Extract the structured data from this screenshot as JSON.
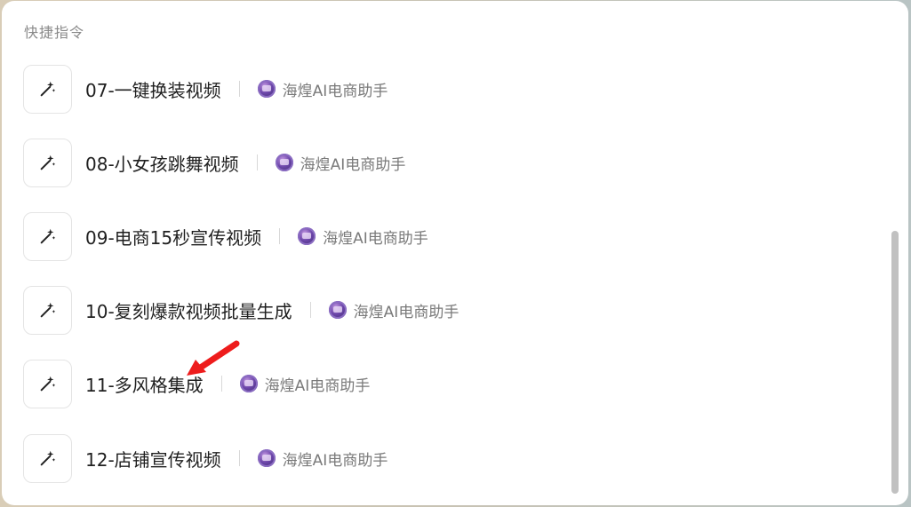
{
  "section_title": "快捷指令",
  "items": [
    {
      "title": "07-一键换装视频",
      "author": "海煌AI电商助手"
    },
    {
      "title": "08-小女孩跳舞视频",
      "author": "海煌AI电商助手"
    },
    {
      "title": "09-电商15秒宣传视频",
      "author": "海煌AI电商助手"
    },
    {
      "title": "10-复刻爆款视频批量生成",
      "author": "海煌AI电商助手"
    },
    {
      "title": "11-多风格集成",
      "author": "海煌AI电商助手"
    },
    {
      "title": "12-店铺宣传视频",
      "author": "海煌AI电商助手"
    }
  ],
  "icons": {
    "item_icon": "magic-wand-icon",
    "annotation": "red-arrow-icon"
  },
  "colors": {
    "annotation_arrow": "#ee1c1c",
    "scrollbar": "#c1c1c1"
  }
}
